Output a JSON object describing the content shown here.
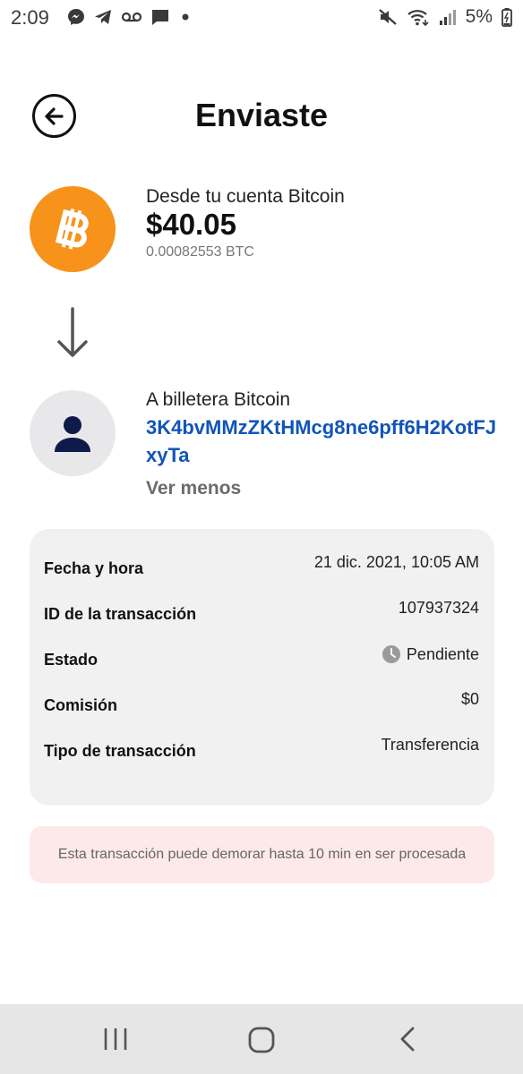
{
  "status_bar": {
    "time": "2:09",
    "battery": "5%",
    "left_icons": [
      "messenger-icon",
      "telegram-icon",
      "voicemail-icon",
      "chat-icon",
      "dot-icon"
    ],
    "right_icons": [
      "mute-icon",
      "wifi-icon",
      "signal-icon",
      "battery-icon"
    ]
  },
  "header": {
    "title": "Enviaste",
    "back_icon": "back-arrow-icon"
  },
  "from": {
    "label": "Desde tu cuenta Bitcoin",
    "amount": "$40.05",
    "btc_amount": "0.00082553 BTC",
    "icon": "bitcoin-icon",
    "icon_color": "#f7931a"
  },
  "to": {
    "label": "A billetera Bitcoin",
    "address": "3K4bvMMzZKtHMcg8ne6pff6H2KotFJxyTa",
    "toggle_label": "Ver menos",
    "icon": "user-icon",
    "address_color": "#1155b8"
  },
  "details": [
    {
      "key": "Fecha y hora",
      "value": "21 dic. 2021, 10:05 AM"
    },
    {
      "key": "ID de la transacción",
      "value": "107937324"
    },
    {
      "key": "Estado",
      "value": "Pendiente",
      "icon": "clock-icon"
    },
    {
      "key": "Comisión",
      "value": "$0"
    },
    {
      "key": "Tipo de transacción",
      "value": "Transferencia"
    }
  ],
  "notice": {
    "text": "Esta transacción puede demorar hasta 10 min en ser procesada",
    "background": "#fde9e9"
  },
  "nav_bar": {
    "icons": [
      "recent-apps-icon",
      "home-icon",
      "back-icon"
    ]
  }
}
